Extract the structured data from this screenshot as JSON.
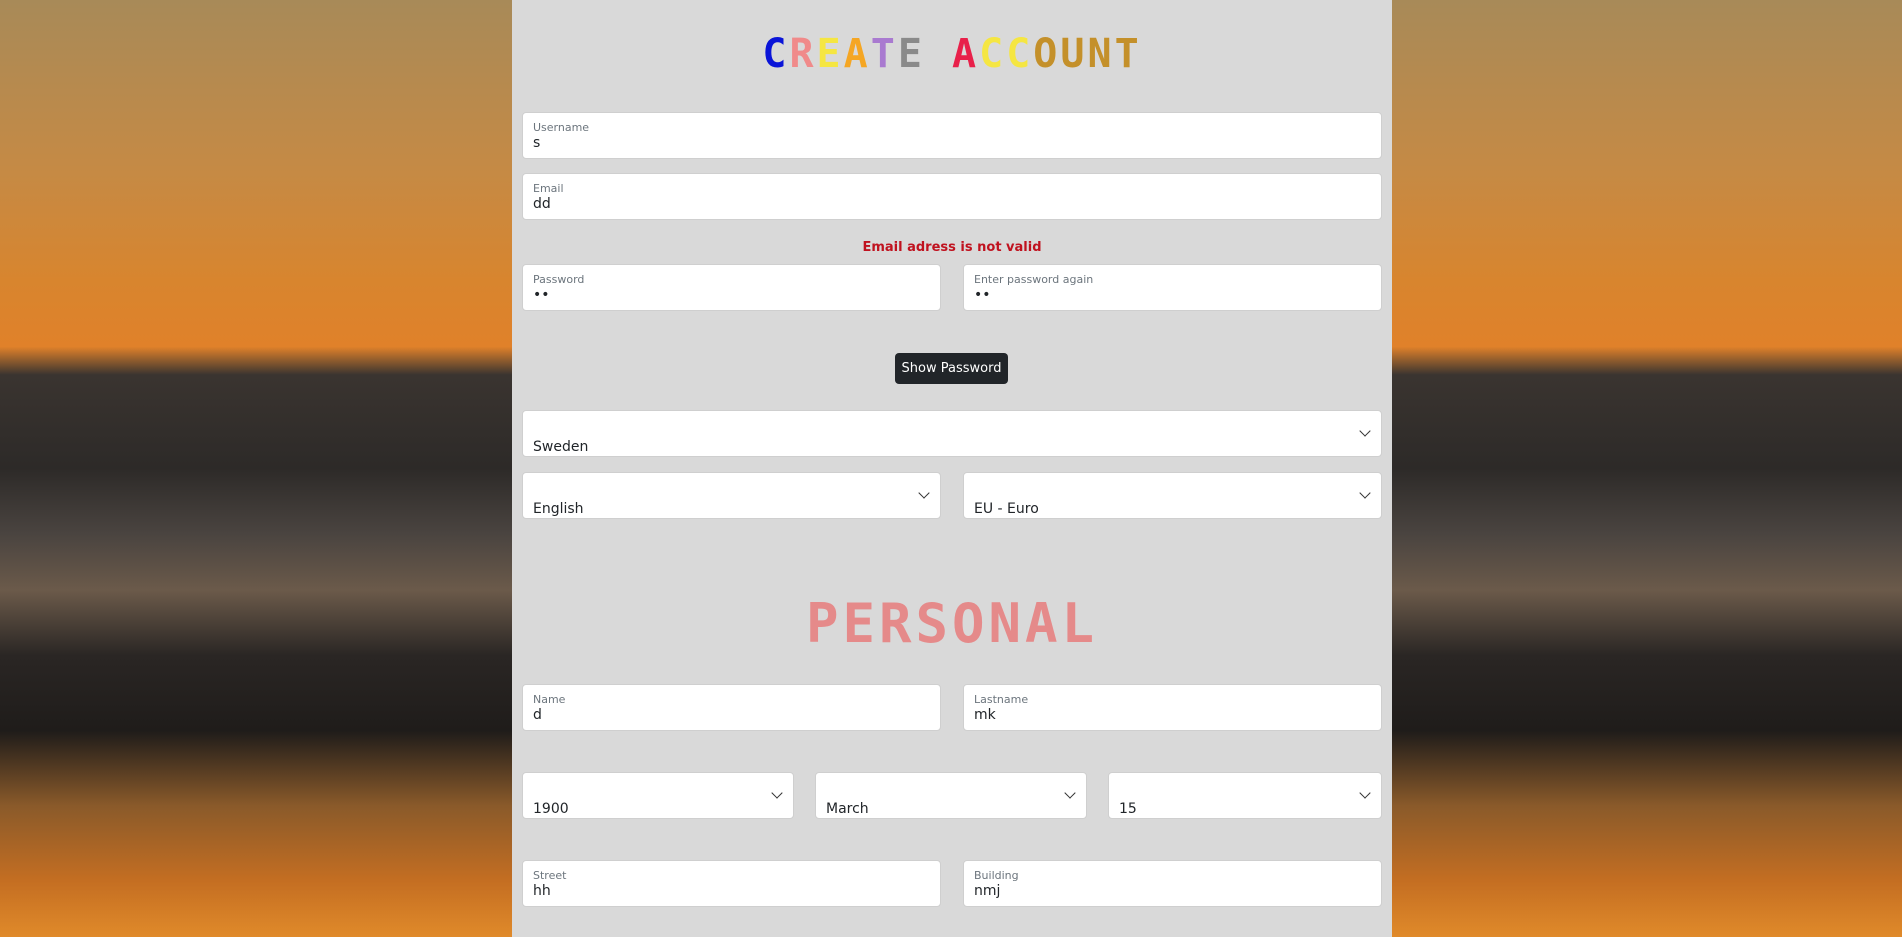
{
  "title": {
    "letters": [
      {
        "ch": "C",
        "color": "#0a14d8"
      },
      {
        "ch": "R",
        "color": "#f08a8a"
      },
      {
        "ch": "E",
        "color": "#f5e642"
      },
      {
        "ch": "A",
        "color": "#f5a623"
      },
      {
        "ch": "T",
        "color": "#a97ad0"
      },
      {
        "ch": "E",
        "color": "#8a8a8a"
      },
      {
        "ch": " ",
        "color": "#000"
      },
      {
        "ch": "A",
        "color": "#e8204a"
      },
      {
        "ch": "C",
        "color": "#f5e642"
      },
      {
        "ch": "C",
        "color": "#f5e642"
      },
      {
        "ch": "O",
        "color": "#c4902a"
      },
      {
        "ch": "U",
        "color": "#c4902a"
      },
      {
        "ch": "N",
        "color": "#c4902a"
      },
      {
        "ch": "T",
        "color": "#c4902a"
      }
    ]
  },
  "username": {
    "label": "Username",
    "value": "s"
  },
  "email": {
    "label": "Email",
    "value": "dd"
  },
  "error": "Email adress is not valid",
  "password": {
    "label": "Password",
    "value": "••"
  },
  "password_again": {
    "label": "Enter password again",
    "value": "••"
  },
  "show_password": "Show Password",
  "country": "Sweden",
  "language": "English",
  "currency": "EU - Euro",
  "personal_title": "PERSONAL",
  "name": {
    "label": "Name",
    "value": "d"
  },
  "lastname": {
    "label": "Lastname",
    "value": "mk"
  },
  "birth_year": "1900",
  "birth_month": "March",
  "birth_day": "15",
  "street": {
    "label": "Street",
    "value": "hh"
  },
  "building": {
    "label": "Building",
    "value": "nmj"
  }
}
